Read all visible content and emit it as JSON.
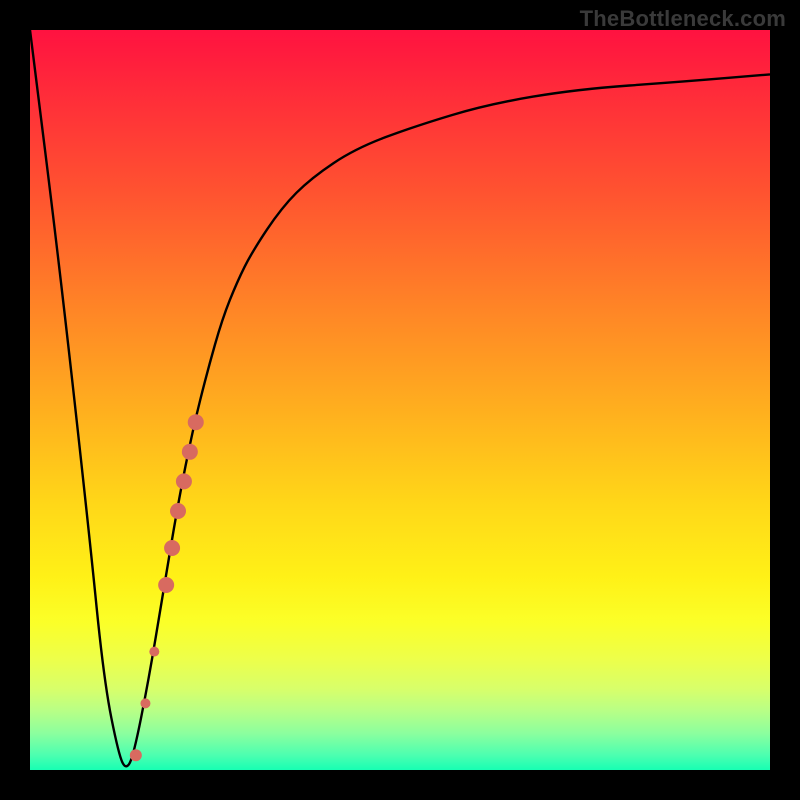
{
  "watermark": "TheBottleneck.com",
  "colors": {
    "frame": "#000000",
    "curve": "#000000",
    "marker": "#d86a60",
    "gradient_top": "#ff1240",
    "gradient_bottom": "#17ffb3"
  },
  "chart_data": {
    "type": "line",
    "title": "",
    "xlabel": "",
    "ylabel": "",
    "xlim": [
      0,
      100
    ],
    "ylim": [
      0,
      100
    ],
    "x": [
      0,
      4,
      8,
      10,
      12,
      13,
      14,
      16,
      18,
      20,
      22,
      24,
      26,
      28,
      30,
      34,
      38,
      44,
      52,
      62,
      74,
      88,
      100
    ],
    "y": [
      100,
      68,
      32,
      12,
      2,
      0,
      2,
      12,
      24,
      36,
      46,
      54,
      61,
      66,
      70,
      76,
      80,
      84,
      87,
      90,
      92,
      93,
      94
    ],
    "markers": {
      "comment": "salmon dots along the ascending branch",
      "points": [
        {
          "x": 14.3,
          "y": 2,
          "r": 6
        },
        {
          "x": 15.6,
          "y": 9,
          "r": 5
        },
        {
          "x": 16.8,
          "y": 16,
          "r": 5
        },
        {
          "x": 18.4,
          "y": 25,
          "r": 8
        },
        {
          "x": 19.2,
          "y": 30,
          "r": 8
        },
        {
          "x": 20.0,
          "y": 35,
          "r": 8
        },
        {
          "x": 20.8,
          "y": 39,
          "r": 8
        },
        {
          "x": 21.6,
          "y": 43,
          "r": 8
        },
        {
          "x": 22.4,
          "y": 47,
          "r": 8
        }
      ]
    }
  }
}
